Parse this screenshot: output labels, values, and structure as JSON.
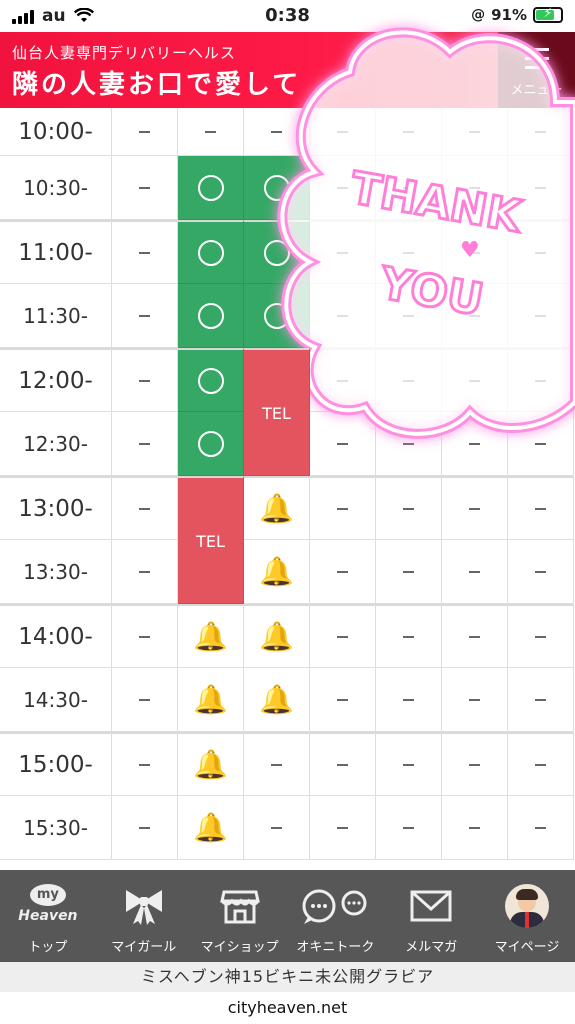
{
  "status_bar": {
    "carrier": "au",
    "time": "0:38",
    "battery_percent": "91%"
  },
  "banner": {
    "subtitle": "仙台人妻専門デリバリーヘルス",
    "title": "隣の人妻お口で愛して",
    "menu_label": "メニュー"
  },
  "schedule": {
    "rows": [
      {
        "time": "10:00-",
        "cells": [
          "dash",
          "dash",
          "dash",
          "dash",
          "dash",
          "dash",
          "dash"
        ]
      },
      {
        "time": "10:30-",
        "cells": [
          "dash",
          "ok",
          "ok",
          "dash",
          "dash",
          "dash",
          "dash"
        ]
      },
      {
        "time": "11:00-",
        "cells": [
          "dash",
          "ok",
          "ok",
          "dash",
          "dash",
          "dash",
          "dash"
        ]
      },
      {
        "time": "11:30-",
        "cells": [
          "dash",
          "ok",
          "ok",
          "dash",
          "dash",
          "dash",
          "dash"
        ]
      },
      {
        "time": "12:00-",
        "cells": [
          "dash",
          "ok",
          "tel",
          "dash",
          "dash",
          "dash",
          "dash"
        ]
      },
      {
        "time": "12:30-",
        "cells": [
          "dash",
          "ok",
          "tel",
          "dash",
          "dash",
          "dash",
          "dash"
        ]
      },
      {
        "time": "13:00-",
        "cells": [
          "dash",
          "tel",
          "bell",
          "dash",
          "dash",
          "dash",
          "dash"
        ]
      },
      {
        "time": "13:30-",
        "cells": [
          "dash",
          "tel",
          "bell",
          "dash",
          "dash",
          "dash",
          "dash"
        ]
      },
      {
        "time": "14:00-",
        "cells": [
          "dash",
          "bell",
          "bell",
          "dash",
          "dash",
          "dash",
          "dash"
        ]
      },
      {
        "time": "14:30-",
        "cells": [
          "dash",
          "bell",
          "bell",
          "dash",
          "dash",
          "dash",
          "dash"
        ]
      },
      {
        "time": "15:00-",
        "cells": [
          "dash",
          "bell",
          "dash",
          "dash",
          "dash",
          "dash",
          "dash"
        ]
      },
      {
        "time": "15:30-",
        "cells": [
          "dash",
          "bell",
          "dash",
          "dash",
          "dash",
          "dash",
          "dash"
        ]
      }
    ],
    "tel_label": "TEL",
    "colors": {
      "available": "#36a866",
      "tel": "#e4545e",
      "bell": "#f8c400"
    }
  },
  "overlay": {
    "line1": "THANK",
    "line2": "YOU",
    "glow_color": "#ff7fd8"
  },
  "nav": {
    "items": [
      {
        "label": "トップ",
        "icon": "my-heaven-icon",
        "icon_text_top": "my",
        "icon_text_bottom": "Heaven"
      },
      {
        "label": "マイガール",
        "icon": "ribbon-icon"
      },
      {
        "label": "マイショップ",
        "icon": "shop-icon"
      },
      {
        "label": "オキニトーク",
        "icon": "chat-bubbles-icon"
      },
      {
        "label": "メルマガ",
        "icon": "mail-icon"
      },
      {
        "label": "マイページ",
        "icon": "avatar-icon"
      }
    ]
  },
  "promo_text": "ミスヘブン神15ビキニ未公開グラビア",
  "domain": "cityheaven.net"
}
